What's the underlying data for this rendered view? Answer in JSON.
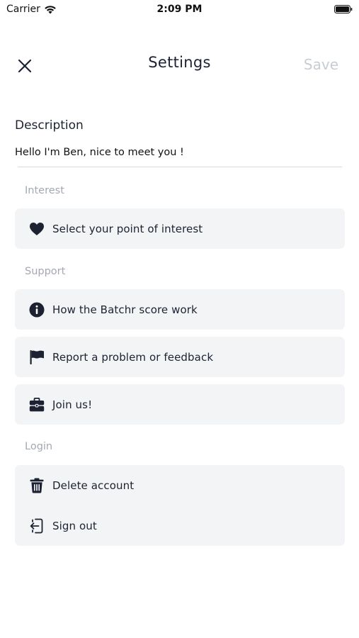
{
  "status_bar": {
    "carrier": "Carrier",
    "time": "2:09 PM"
  },
  "nav": {
    "close_icon": "close-icon",
    "title": "Settings",
    "save_label": "Save"
  },
  "description": {
    "label": "Description",
    "value": "Hello I'm Ben, nice to meet you !"
  },
  "sections": {
    "interest": {
      "label": "Interest",
      "items": [
        {
          "label": "Select your point of interest",
          "icon": "heart-icon"
        }
      ]
    },
    "support": {
      "label": "Support",
      "items": [
        {
          "label": "How the Batchr score work",
          "icon": "info-icon"
        },
        {
          "label": "Report a problem or feedback",
          "icon": "flag-icon"
        },
        {
          "label": "Join us!",
          "icon": "briefcase-icon"
        }
      ]
    },
    "login": {
      "label": "Login",
      "items": [
        {
          "label": "Delete account",
          "icon": "trash-icon"
        },
        {
          "label": "Sign out",
          "icon": "sign-out-icon"
        }
      ]
    }
  },
  "colors": {
    "text": "#1d2232",
    "muted": "#a3a8b1",
    "card_bg": "#f3f4f6",
    "save_disabled": "#c8ccd3"
  }
}
